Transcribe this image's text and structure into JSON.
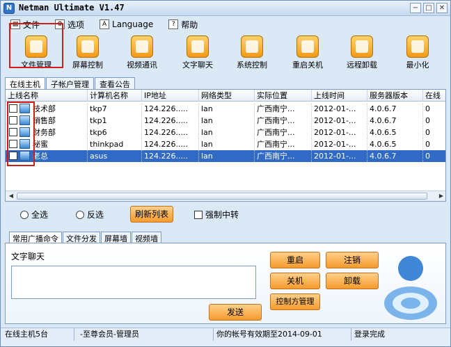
{
  "window": {
    "title": "Netman Ultimate V1.47"
  },
  "menu": [
    {
      "label": "文件",
      "icon": "document-icon"
    },
    {
      "label": "选项",
      "icon": "options-icon"
    },
    {
      "label": "Language",
      "icon": "language-icon"
    },
    {
      "label": "帮助",
      "icon": "help-icon"
    }
  ],
  "toolbar": [
    {
      "label": "文件管理",
      "icon": "file-manager-icon"
    },
    {
      "label": "屏幕控制",
      "icon": "screen-control-icon"
    },
    {
      "label": "视频通讯",
      "icon": "video-chat-icon"
    },
    {
      "label": "文字聊天",
      "icon": "text-chat-icon"
    },
    {
      "label": "系统控制",
      "icon": "system-control-icon"
    },
    {
      "label": "重启关机",
      "icon": "power-icon"
    },
    {
      "label": "远程卸载",
      "icon": "uninstall-icon"
    },
    {
      "label": "最小化",
      "icon": "minimize-icon"
    }
  ],
  "tabs": [
    "在线主机",
    "子帐户管理",
    "查看公告"
  ],
  "table": {
    "headers": [
      "上线名称",
      "计算机名称",
      "IP地址",
      "网络类型",
      "实际位置",
      "上线时间",
      "服务器版本",
      "在线"
    ],
    "rows": [
      [
        "技术部",
        "tkp7",
        "124.226.....",
        "lan",
        "广西南宁...",
        "2012-01-...",
        "4.0.6.7",
        "0"
      ],
      [
        "销售部",
        "tkp1",
        "124.226.....",
        "lan",
        "广西南宁...",
        "2012-01-...",
        "4.0.6.7",
        "0"
      ],
      [
        "财务部",
        "tkp6",
        "124.226.....",
        "lan",
        "广西南宁...",
        "2012-01-...",
        "4.0.6.5",
        "0"
      ],
      [
        "秘蜜",
        "thinkpad",
        "124.226.....",
        "lan",
        "广西南宁...",
        "2012-01-...",
        "4.0.6.5",
        "0"
      ],
      [
        "老总",
        "asus",
        "124.226.....",
        "lan",
        "广西南宁...",
        "2012-01-...",
        "4.0.6.7",
        "0"
      ]
    ],
    "selected_row": 4
  },
  "controls": {
    "select_all": "全选",
    "invert_select": "反选",
    "refresh": "刷新列表",
    "force_relay": "强制中转"
  },
  "tabs2": [
    "常用广播命令",
    "文件分发",
    "屏幕墙",
    "视频墙"
  ],
  "broadcast": {
    "chat_label": "文字聊天",
    "restart": "重启",
    "logout": "注销",
    "shutdown": "关机",
    "uninstall": "卸载",
    "controller_manage": "控制方管理",
    "send": "发送"
  },
  "status": {
    "online_hosts": "在线主机5台",
    "member": "-至尊会员-管理员",
    "expiry": "你的帐号有效期至2014-09-01",
    "login": "登录完成"
  },
  "colors": {
    "selection": "#316ac5",
    "accent": "#f59a2c",
    "highlight_box": "#d21c1c"
  }
}
